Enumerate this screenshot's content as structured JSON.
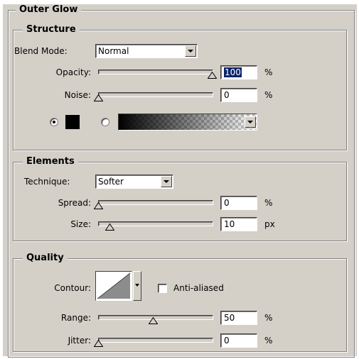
{
  "outer_glow": {
    "title": "Outer Glow",
    "structure": {
      "title": "Structure",
      "blend_mode": {
        "label": "Blend Mode:",
        "value": "Normal"
      },
      "opacity": {
        "label": "Opacity:",
        "value": "100",
        "unit": "%",
        "slider_fraction": 1.0
      },
      "noise": {
        "label": "Noise:",
        "value": "0",
        "unit": "%",
        "slider_fraction": 0.0
      },
      "color_radio_selected": "solid-color",
      "solid_color": "#000000",
      "gradient": {
        "from": "#000000",
        "to": "transparent"
      }
    },
    "elements": {
      "title": "Elements",
      "technique": {
        "label": "Technique:",
        "value": "Softer"
      },
      "spread": {
        "label": "Spread:",
        "value": "0",
        "unit": "%",
        "slider_fraction": 0.0
      },
      "size": {
        "label": "Size:",
        "value": "10",
        "unit": "px",
        "slider_fraction": 0.06
      }
    },
    "quality": {
      "title": "Quality",
      "contour": {
        "label": "Contour:"
      },
      "anti_aliased": {
        "label": "Anti-aliased",
        "checked": false
      },
      "range": {
        "label": "Range:",
        "value": "50",
        "unit": "%",
        "slider_fraction": 0.5
      },
      "jitter": {
        "label": "Jitter:",
        "value": "0",
        "unit": "%",
        "slider_fraction": 0.0
      }
    }
  },
  "colors": {
    "face": "#d4d0c8",
    "shadow": "#808080",
    "highlight": "#ffffff",
    "selection": "#0a246a"
  }
}
